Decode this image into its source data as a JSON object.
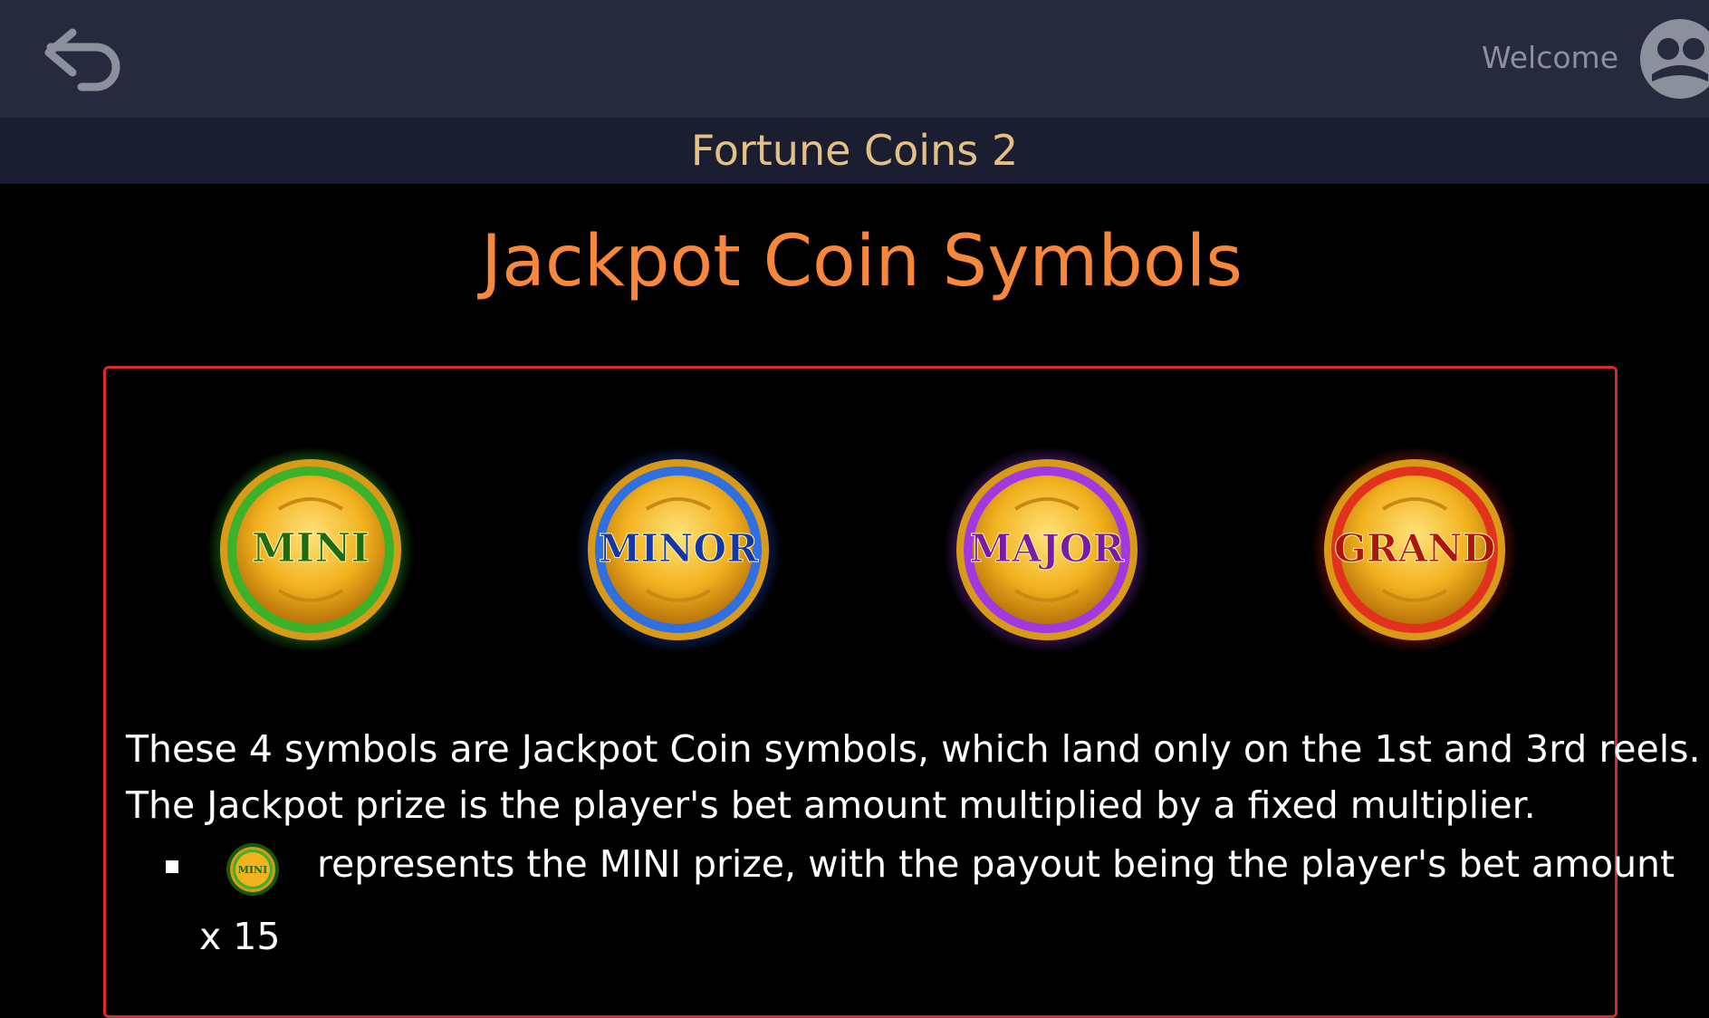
{
  "header": {
    "back_icon": "back-arrow-icon",
    "welcome_label": "Welcome",
    "avatar_icon": "user-avatar-icon"
  },
  "subheader": {
    "game_title": "Fortune Coins 2"
  },
  "main": {
    "heading": "Jackpot Coin Symbols",
    "coins": [
      {
        "label": "MINI",
        "ring_color": "#3bb22a",
        "glow_color": "#3cff2a",
        "text_color": "#1f6b12"
      },
      {
        "label": "MINOR",
        "ring_color": "#2f6fe0",
        "glow_color": "#1f5cff",
        "text_color": "#1437a8"
      },
      {
        "label": "MAJOR",
        "ring_color": "#a238e0",
        "glow_color": "#b040ff",
        "text_color": "#7a1aa8"
      },
      {
        "label": "GRAND",
        "ring_color": "#e2321e",
        "glow_color": "#ff2a10",
        "text_color": "#b01410"
      }
    ],
    "description_line1": "These 4 symbols are Jackpot Coin symbols, which land only on the 1st and 3rd reels.",
    "description_line2": "The Jackpot prize is the player's bet amount multiplied by a fixed multiplier.",
    "bullets": [
      {
        "coin_label": "MINI",
        "text": "represents the MINI prize, with the payout being the player's bet amount",
        "multiplier": "x 15"
      }
    ]
  },
  "colors": {
    "topbar_bg": "#262a3c",
    "subbar_bg": "#1b1e30",
    "title_gold": "#e4c085",
    "heading_orange": "#f7873a",
    "panel_border": "#d62b2b"
  }
}
